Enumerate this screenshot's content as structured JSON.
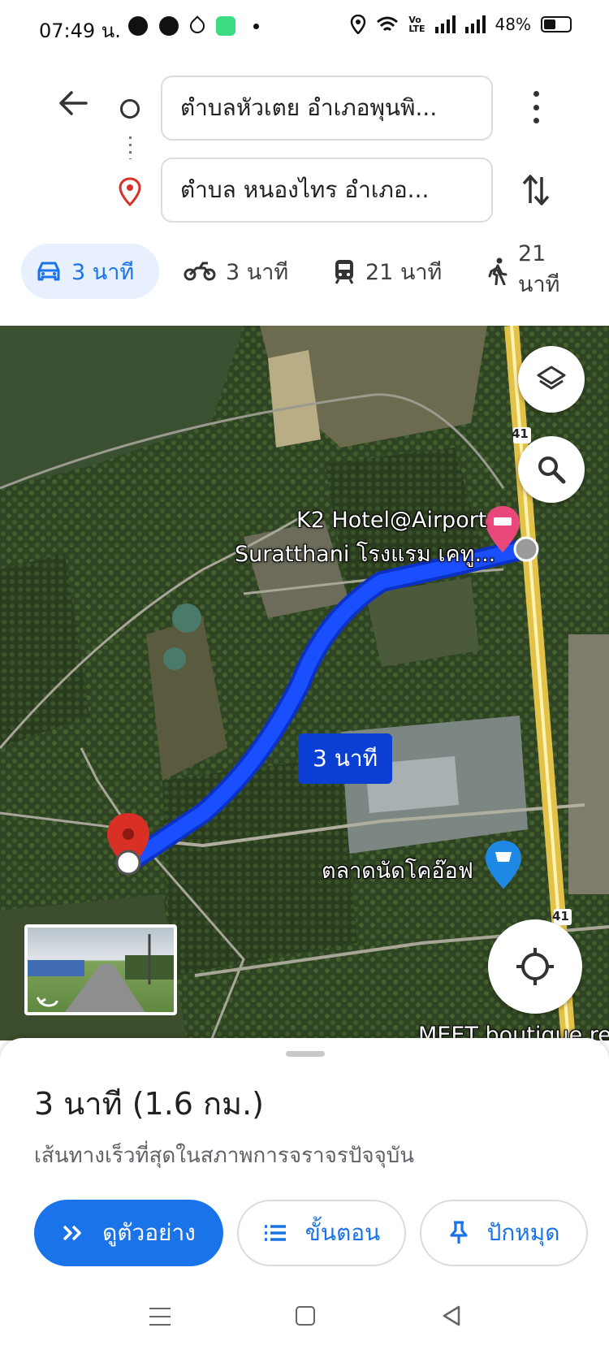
{
  "status_bar": {
    "time": "07:49 น.",
    "battery": "48%",
    "volte_top": "Vo",
    "volte_bottom": "LTE",
    "icons": [
      "chat-bubble-icon",
      "messenger-icon",
      "drop-icon",
      "app-icon",
      "dot-icon",
      "location-icon",
      "wifi-icon",
      "signal-icon",
      "signal-icon",
      "battery-icon"
    ]
  },
  "directions": {
    "origin": "ตำบลหัวเตย อำเภอพุนพิ...",
    "destination": "ตำบล หนองไทร อำเภอ..."
  },
  "modes": [
    {
      "icon": "car-icon",
      "label": "3 นาที",
      "active": true
    },
    {
      "icon": "motorcycle-icon",
      "label": "3 นาที",
      "active": false
    },
    {
      "icon": "transit-icon",
      "label": "21 นาที",
      "active": false
    },
    {
      "icon": "walk-icon",
      "label": "21 นาที",
      "active": false
    }
  ],
  "map": {
    "hotel_label_line1": "K2 Hotel@Airport",
    "hotel_label_line2": "Suratthani โรงแรม เคทู...",
    "route_badge": "3 นาที",
    "market_label": "ตลาดนัดโคอ๊อฟ",
    "highway_number_top": "41",
    "highway_number_bottom": "41",
    "bottom_edge_label": "MEET boutique res",
    "route_color": "#1a4fff"
  },
  "sheet": {
    "title": "3 นาที (1.6 กม.)",
    "subtitle": "เส้นทางเร็วที่สุดในสภาพการจราจรปัจจุบัน",
    "preview_label": "ดูตัวอย่าง",
    "steps_label": "ขั้นตอน",
    "pin_label": "ปักหมุด"
  },
  "colors": {
    "accent": "#1a73e8",
    "pin_red": "#d93025",
    "hotel_pink": "#e8497a"
  }
}
